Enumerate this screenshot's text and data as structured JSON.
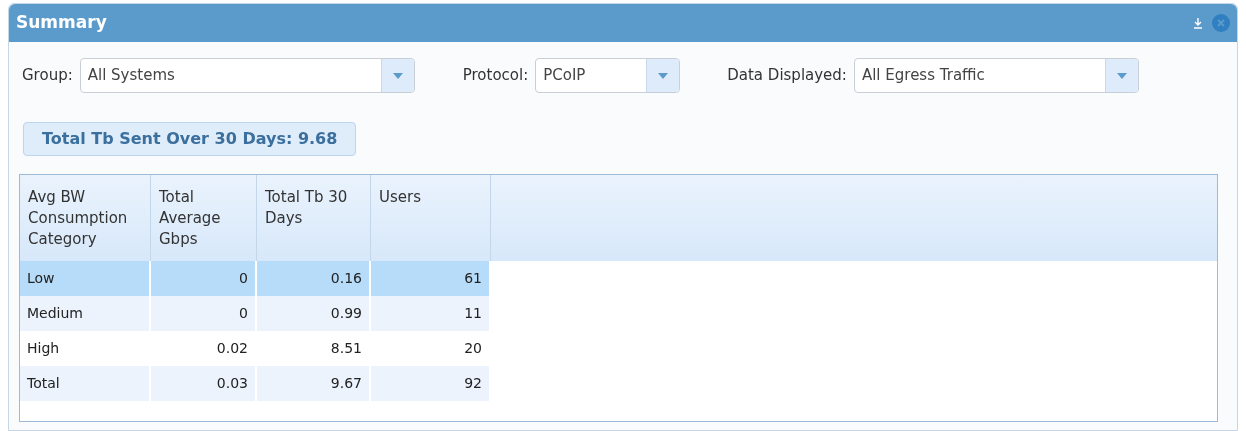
{
  "panel": {
    "title": "Summary"
  },
  "filters": [
    {
      "label": "Group:",
      "value": "All Systems"
    },
    {
      "label": "Protocol:",
      "value": "PCoIP"
    },
    {
      "label": "Data Displayed:",
      "value": "All Egress Traffic"
    }
  ],
  "total_badge": "Total Tb Sent Over 30 Days: 9.68",
  "table": {
    "columns": [
      "Avg BW Consumption Category",
      "Total Average Gbps",
      "Total Tb 30 Days",
      "Users"
    ],
    "rows": [
      {
        "cells": [
          "Low",
          "0",
          "0.16",
          "61"
        ],
        "selected": true
      },
      {
        "cells": [
          "Medium",
          "0",
          "0.99",
          "11"
        ],
        "selected": false
      },
      {
        "cells": [
          "High",
          "0.02",
          "8.51",
          "20"
        ],
        "selected": false
      },
      {
        "cells": [
          "Total",
          "0.03",
          "9.67",
          "92"
        ],
        "selected": false
      }
    ]
  }
}
